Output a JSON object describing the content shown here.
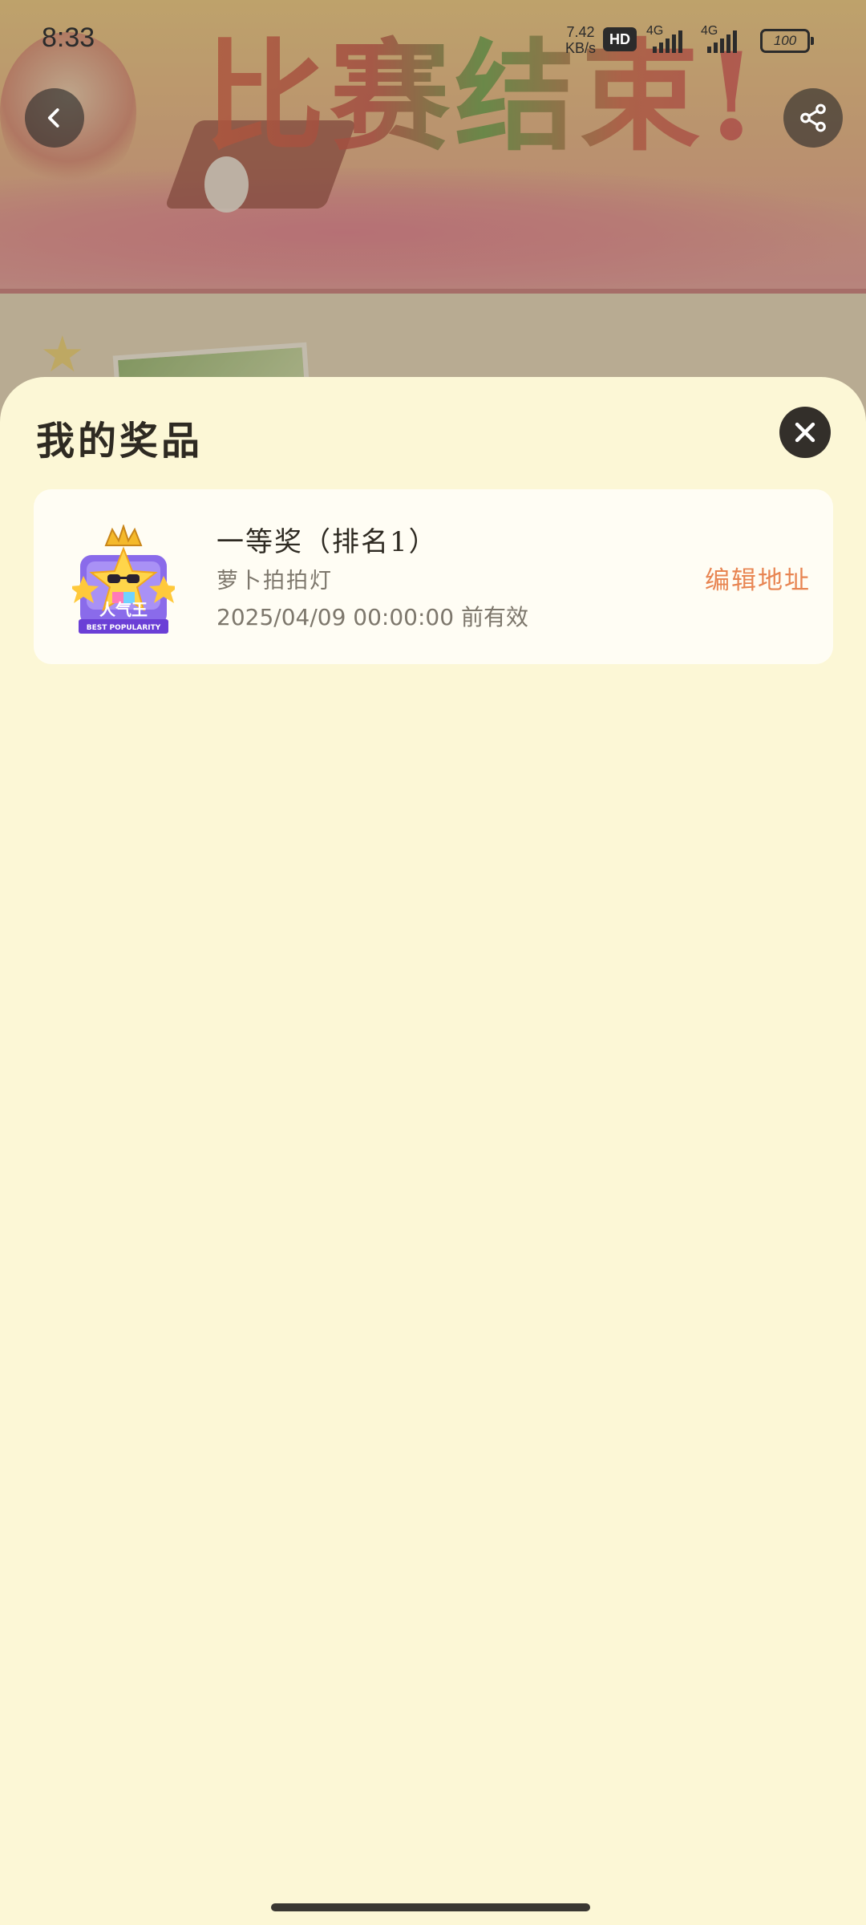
{
  "status_bar": {
    "time": "8:33",
    "net_speed_value": "7.42",
    "net_speed_unit": "KB/s",
    "hd_label": "HD",
    "sim1_label": "4G",
    "sim2_label": "4G",
    "battery_level": "100"
  },
  "background": {
    "banner_text": "比赛结束!"
  },
  "nav": {
    "back_icon": "chevron-left-icon",
    "share_icon": "share-icon"
  },
  "sheet": {
    "title": "我的奖品",
    "close_icon": "close-icon",
    "prizes": [
      {
        "name": "一等奖（排名1）",
        "description": "萝卜拍拍灯",
        "expiry": "2025/04/09 00:00:00 前有效",
        "badge_text": "人气王",
        "badge_subtext": "BEST POPULARITY",
        "action_label": "编辑地址"
      }
    ]
  },
  "colors": {
    "sheet_bg": "#fcf7d6",
    "card_bg": "#fffdf4",
    "accent_orange": "#e88552",
    "title_text": "#2e2a22",
    "secondary_text": "#7d776c"
  }
}
